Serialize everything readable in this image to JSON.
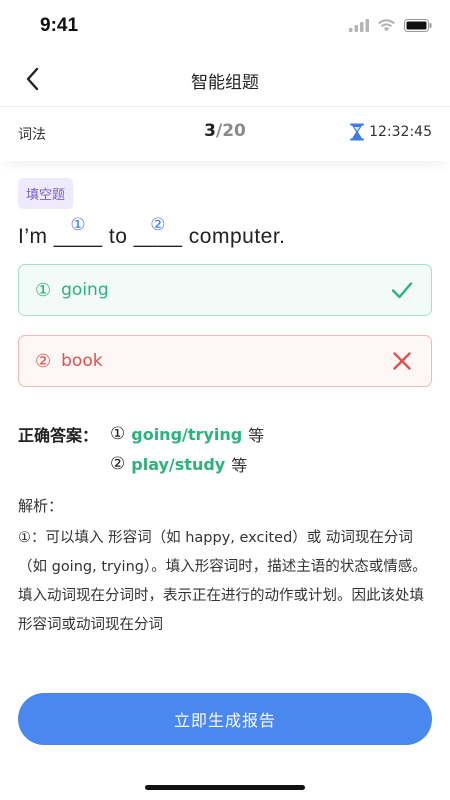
{
  "status_bar": {
    "time": "9:41"
  },
  "nav": {
    "title": "智能组题"
  },
  "info": {
    "category": "词法",
    "current": "3",
    "separator": "/",
    "total": "20",
    "timer": "12:32:45"
  },
  "question": {
    "tag": "填空题",
    "part1": "I’m ",
    "blank": "____",
    "part2": " to ",
    "part3": " computer.",
    "blank1_num": "①",
    "blank2_num": "②"
  },
  "options": [
    {
      "label": "①",
      "text": "going",
      "status": "correct"
    },
    {
      "label": "②",
      "text": "book",
      "status": "wrong"
    }
  ],
  "answer": {
    "title": "正确答案：",
    "items": [
      {
        "num": "①",
        "value": "going/trying",
        "suffix": "等"
      },
      {
        "num": "②",
        "value": "play/study",
        "suffix": "等"
      }
    ]
  },
  "analysis": {
    "title": "解析：",
    "text": "①：可以填入 形容词（如 happy, excited）或 动词现在分词（如 going, trying）。填入形容词时，描述主语的状态或情感。填入动词现在分词时，表示正在进行的动作或计划。因此该处填形容词或动词现在分词"
  },
  "button": {
    "label": "立即生成报告"
  },
  "colors": {
    "accent": "#4a87ee",
    "correct": "#2cb37c",
    "wrong": "#e0524e",
    "tag_bg": "#eee9fb",
    "tag_text": "#7a61c9"
  }
}
